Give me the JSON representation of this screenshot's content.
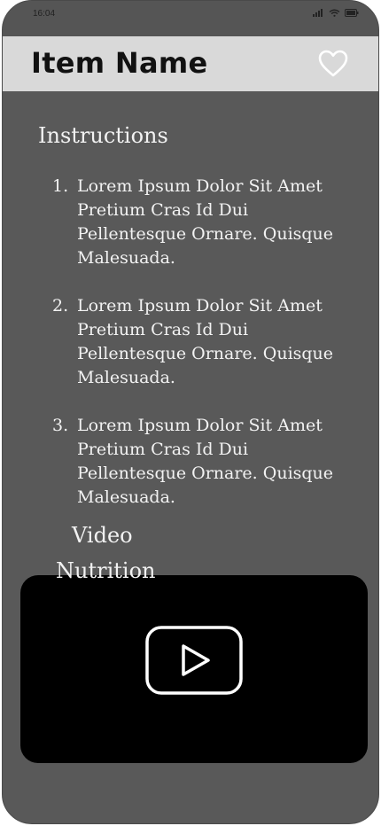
{
  "status": {
    "time": "16:04"
  },
  "header": {
    "title": "Item Name",
    "favorite_icon": "heart-outline-icon"
  },
  "instructions": {
    "heading": "Instructions",
    "steps": [
      {
        "number": "1.",
        "text": "Lorem Ipsum Dolor Sit Amet Pretium Cras Id Dui Pellentesque Ornare. Quisque Malesuada."
      },
      {
        "number": "2.",
        "text": "Lorem Ipsum Dolor Sit Amet Pretium Cras Id Dui Pellentesque Ornare. Quisque Malesuada."
      },
      {
        "number": "3.",
        "text": "Lorem Ipsum Dolor Sit Amet Pretium Cras Id Dui Pellentesque Ornare. Quisque Malesuada."
      }
    ]
  },
  "video": {
    "heading": "Video",
    "play_icon": "play-icon"
  },
  "nutrition": {
    "heading": "Nutrition"
  },
  "colors": {
    "background": "#595959",
    "header": "#d9d9d9",
    "video_card": "#000000",
    "text": "#f2f2f2"
  }
}
